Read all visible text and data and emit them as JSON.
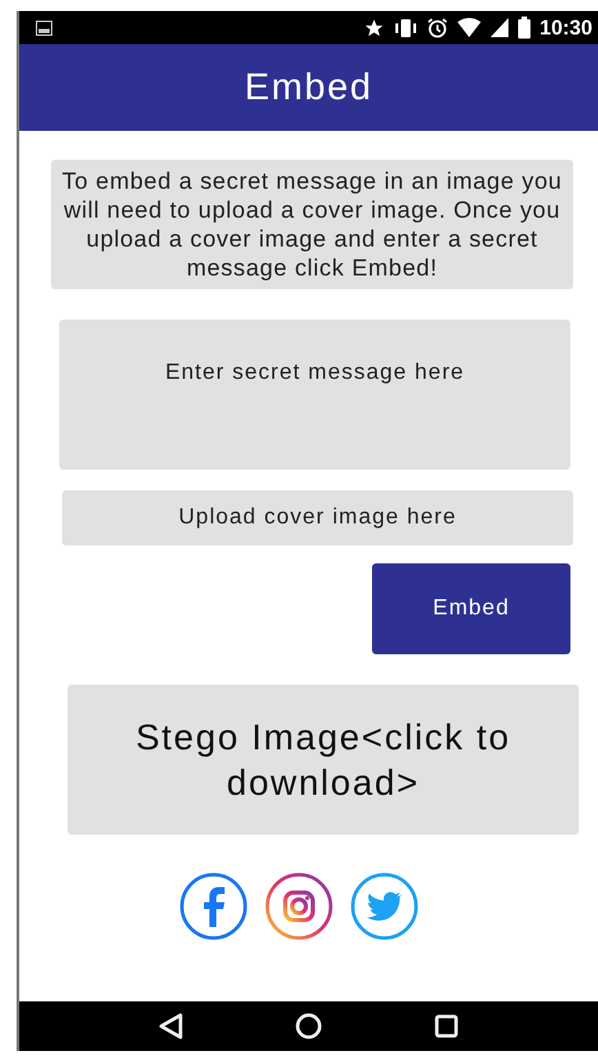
{
  "status_bar": {
    "time": "10:30"
  },
  "app_bar": {
    "title": "Embed"
  },
  "instructions": "To embed a secret message in an image you will need to upload a cover image. Once you upload a cover image and enter a secret message click Embed!",
  "message_field": {
    "placeholder": "Enter secret message here"
  },
  "cover_field": {
    "placeholder": "Upload cover image here"
  },
  "embed_button": {
    "label": "Embed"
  },
  "stego_image": {
    "label": "Stego Image<click to download>"
  },
  "social_links": [
    {
      "kind": "facebook"
    },
    {
      "kind": "instagram"
    },
    {
      "kind": "twitter"
    }
  ]
}
